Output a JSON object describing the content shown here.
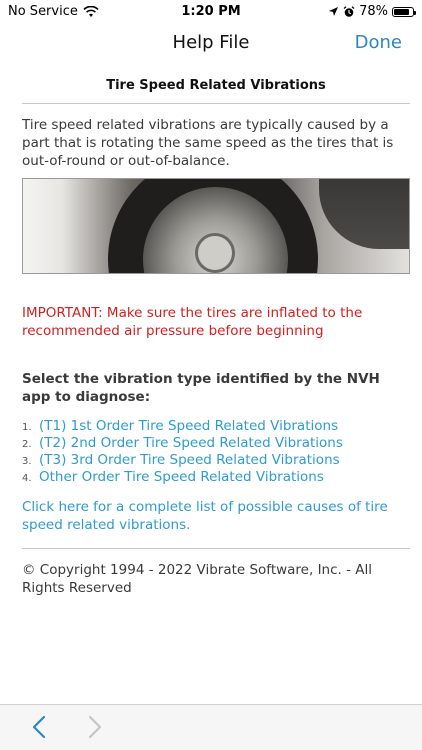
{
  "status_bar": {
    "carrier": "No Service",
    "time": "1:20 PM",
    "battery": "78%",
    "icons": [
      "wifi-icon",
      "location-icon",
      "alarm-icon",
      "battery-icon"
    ]
  },
  "nav": {
    "title": "Help File",
    "done_label": "Done",
    "accent_color": "#2f86c6"
  },
  "article": {
    "title": "Tire Speed Related Vibrations",
    "intro": "Tire speed related vibrations are typically caused by a part that is rotating the same speed as the tires that is out-of-round or out-of-balance.",
    "important": "IMPORTANT: Make sure the tires are inflated to the recommended air pressure before beginning",
    "important_color": "#d21f1f",
    "select_heading": "Select the vibration type identified by the NVH app to diagnose:",
    "vibration_types": [
      {
        "number": "1.",
        "label": "(T1) 1st Order Tire Speed Related Vibrations"
      },
      {
        "number": "2.",
        "label": "(T2) 2nd Order Tire Speed Related Vibrations"
      },
      {
        "number": "3.",
        "label": "(T3) 3rd Order Tire Speed Related Vibrations"
      },
      {
        "number": "4.",
        "label": "Other Order Tire Speed Related Vibrations"
      }
    ],
    "link_color": "#2f9bd1",
    "causes_link": "Click here for a complete list of possible causes of tire speed related vibrations.",
    "copyright": "© Copyright 1994 - 2022 Vibrate Software, Inc. - All Rights Reserved"
  },
  "toolbar": {
    "back_icon": "chevron-left-icon",
    "forward_icon": "chevron-right-icon"
  }
}
